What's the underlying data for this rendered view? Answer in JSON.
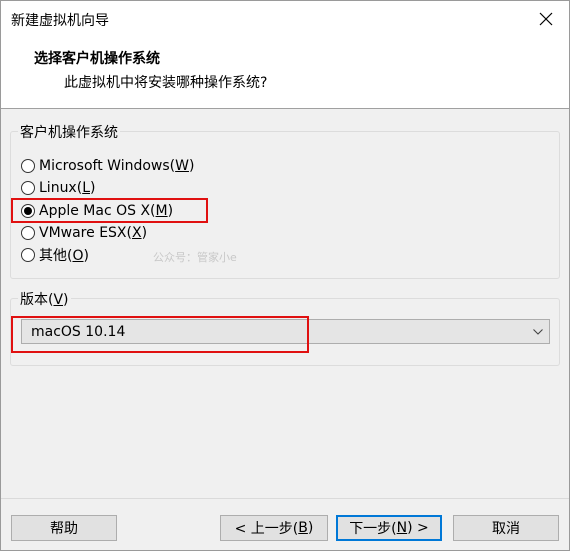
{
  "window": {
    "title": "新建虚拟机向导"
  },
  "header": {
    "title": "选择客户机操作系统",
    "subtitle": "此虚拟机中将安装哪种操作系统?"
  },
  "guest_os": {
    "legend": "客户机操作系统",
    "options": [
      {
        "label": "Microsoft Windows(",
        "mnemonic": "W",
        "suffix": ")",
        "selected": false
      },
      {
        "label": "Linux(",
        "mnemonic": "L",
        "suffix": ")",
        "selected": false
      },
      {
        "label": "Apple Mac OS X(",
        "mnemonic": "M",
        "suffix": ")",
        "selected": true
      },
      {
        "label": "VMware ESX(",
        "mnemonic": "X",
        "suffix": ")",
        "selected": false
      },
      {
        "label": "其他(",
        "mnemonic": "O",
        "suffix": ")",
        "selected": false
      }
    ]
  },
  "version": {
    "legend_prefix": "版本(",
    "legend_mnemonic": "V",
    "legend_suffix": ")",
    "selected": "macOS 10.14"
  },
  "watermark": "公众号：管家小e",
  "buttons": {
    "help": "帮助",
    "back_prefix": "< 上一步(",
    "back_mnemonic": "B",
    "back_suffix": ")",
    "next_prefix": "下一步(",
    "next_mnemonic": "N",
    "next_suffix": ") >",
    "cancel": "取消"
  },
  "colors": {
    "highlight": "#e01010",
    "default_button_border": "#0078d7"
  }
}
